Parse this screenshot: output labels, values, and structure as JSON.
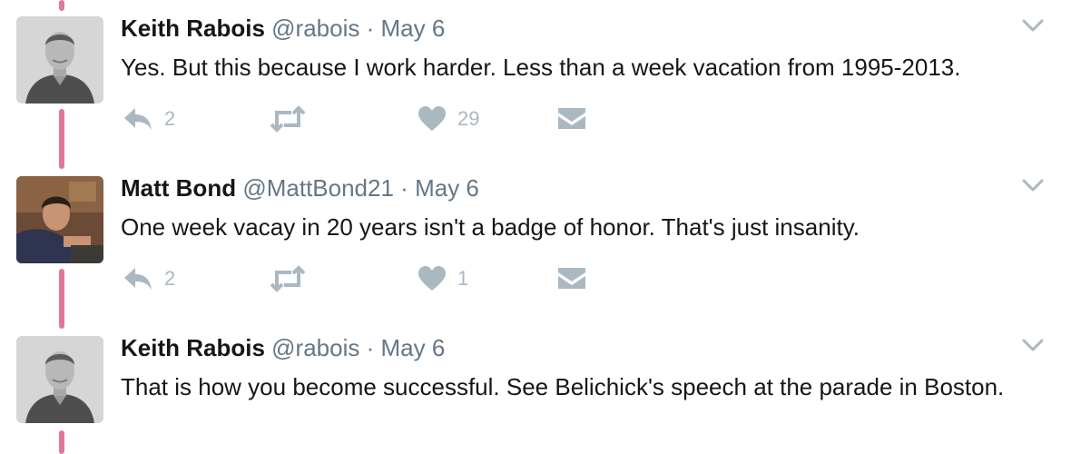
{
  "colors": {
    "thread_line": "#e0789a",
    "name_text": "#14171a",
    "muted_text": "#657786",
    "action_icon": "#aab8c2"
  },
  "icons": {
    "reply": "reply-icon",
    "retweet": "retweet-icon",
    "like": "heart-icon",
    "message": "envelope-icon",
    "menu": "chevron-down-icon"
  },
  "tweets": [
    {
      "name": "Keith Rabois",
      "handle": "@rabois",
      "separator": "·",
      "date": "May 6",
      "text": "Yes. But this because I work harder.  Less than a week vacation from 1995-2013.",
      "reply_count": "2",
      "retweet_count": "",
      "like_count": "29"
    },
    {
      "name": "Matt Bond",
      "handle": "@MattBond21",
      "separator": "·",
      "date": "May 6",
      "text": "One week vacay in 20 years isn't a badge of honor. That's just insanity.",
      "reply_count": "2",
      "retweet_count": "",
      "like_count": "1"
    },
    {
      "name": "Keith Rabois",
      "handle": "@rabois",
      "separator": "·",
      "date": "May 6",
      "text": "That is how you become successful.  See Belichick's speech at the parade in Boston.",
      "reply_count": "",
      "retweet_count": "",
      "like_count": ""
    }
  ]
}
